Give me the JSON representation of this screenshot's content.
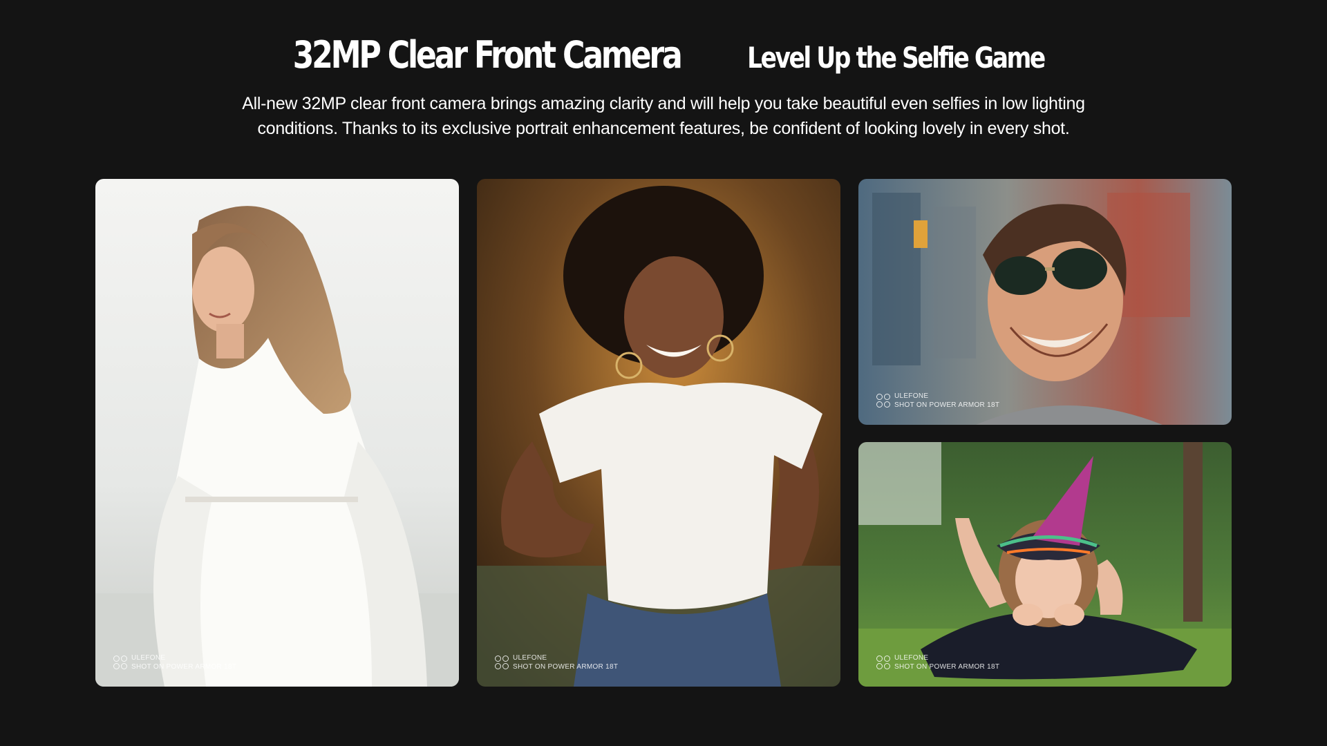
{
  "header": {
    "title": "32MP Clear Front Camera",
    "subtitle": "Level Up the Selfie Game",
    "description": "All-new 32MP clear front camera brings amazing clarity and will help you take beautiful even selfies in low lighting conditions. Thanks to its exclusive portrait enhancement features, be confident of looking lovely in every shot."
  },
  "gallery": {
    "photos": [
      {
        "watermark_brand": "ULEFONE",
        "watermark_caption": "SHOT ON POWER ARMOR 18T"
      },
      {
        "watermark_brand": "ULEFONE",
        "watermark_caption": "SHOT ON POWER ARMOR 18T"
      },
      {
        "watermark_brand": "ULEFONE",
        "watermark_caption": "SHOT ON POWER ARMOR 18T"
      },
      {
        "watermark_brand": "ULEFONE",
        "watermark_caption": "SHOT ON POWER ARMOR 18T"
      }
    ]
  },
  "colors": {
    "background": "#141414",
    "text": "#ffffff"
  }
}
